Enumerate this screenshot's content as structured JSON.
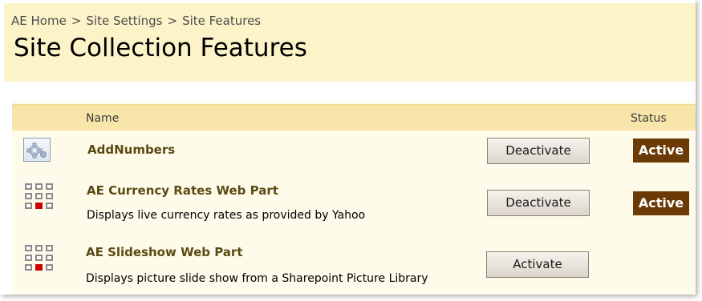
{
  "breadcrumb": {
    "items": [
      "AE Home",
      "Site Settings",
      "Site Features"
    ],
    "separator": ">"
  },
  "page": {
    "title": "Site Collection Features"
  },
  "table": {
    "headers": {
      "name": "Name",
      "status": "Status"
    },
    "features": [
      {
        "name": "AddNumbers",
        "description": "",
        "icon": "gear-feature-icon",
        "button_label": "Deactivate",
        "status": "Active"
      },
      {
        "name": "AE Currency Rates Web Part",
        "description": "Displays live currency rates as provided by Yahoo",
        "icon": "web-part-grid-icon",
        "button_label": "Deactivate",
        "status": "Active"
      },
      {
        "name": "AE Slideshow Web Part",
        "description": "Displays picture slide show from a Sharepoint Picture Library",
        "icon": "web-part-grid-icon",
        "button_label": "Activate",
        "status": ""
      }
    ]
  },
  "colors": {
    "title_bg": "#fcf3c8",
    "header_bg": "#f7e5a9",
    "content_bg": "#fffbea",
    "status_active_bg": "#6b3a06",
    "feature_name": "#5a4a14"
  }
}
